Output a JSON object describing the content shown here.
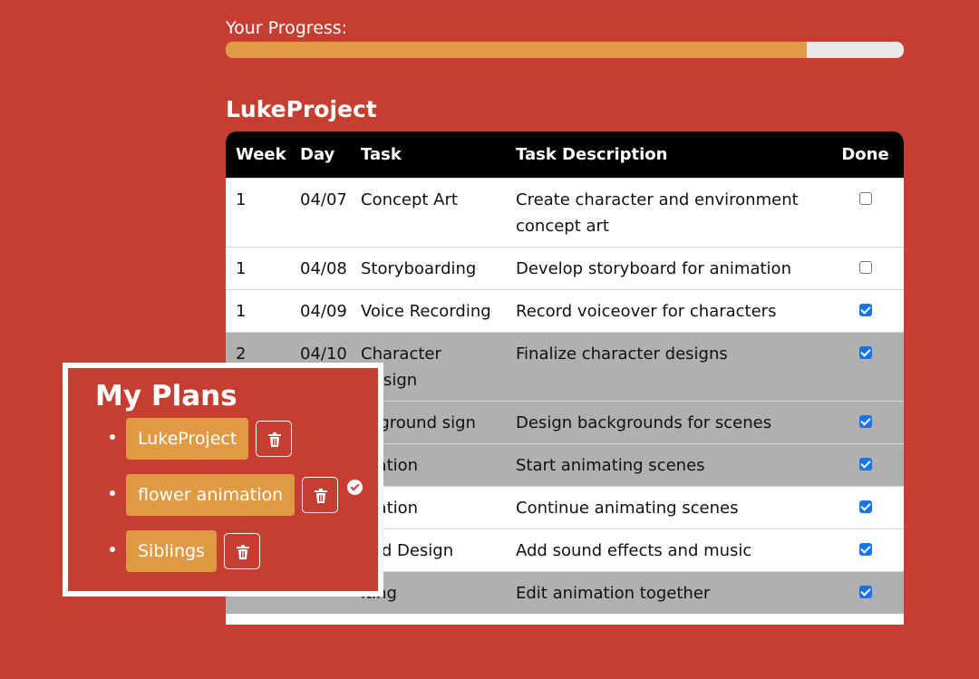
{
  "progress": {
    "label": "Your Progress:",
    "fraction": 0.857
  },
  "project": {
    "title": "LukeProject"
  },
  "table": {
    "columns": [
      "Week",
      "Day",
      "Task",
      "Task Description",
      "Done"
    ],
    "rows": [
      {
        "week": "1",
        "day": "04/07",
        "task": "Concept Art",
        "description": "Create character and environment concept art",
        "done": false,
        "shade": "white"
      },
      {
        "week": "1",
        "day": "04/08",
        "task": "Storyboarding",
        "description": "Develop storyboard for animation",
        "done": false,
        "shade": "white"
      },
      {
        "week": "1",
        "day": "04/09",
        "task": "Voice Recording",
        "description": "Record voiceover for characters",
        "done": true,
        "shade": "white"
      },
      {
        "week": "2",
        "day": "04/10",
        "task": "Character Design",
        "description": "Finalize character designs",
        "done": true,
        "shade": "gray"
      },
      {
        "week": "",
        "day": "",
        "task": "ckground sign",
        "description": "Design backgrounds for scenes",
        "done": true,
        "shade": "gray"
      },
      {
        "week": "",
        "day": "",
        "task": "mation",
        "description": "Start animating scenes",
        "done": true,
        "shade": "gray"
      },
      {
        "week": "",
        "day": "",
        "task": "mation",
        "description": "Continue animating scenes",
        "done": true,
        "shade": "white"
      },
      {
        "week": "",
        "day": "",
        "task": "und Design",
        "description": "Add sound effects and music",
        "done": true,
        "shade": "white"
      },
      {
        "week": "",
        "day": "",
        "task": "iting",
        "description": "Edit animation together",
        "done": true,
        "shade": "gray"
      }
    ]
  },
  "plans": {
    "title": "My Plans",
    "items": [
      {
        "name": "LukeProject",
        "selected": false
      },
      {
        "name": "flower animation",
        "selected": true
      },
      {
        "name": "Siblings",
        "selected": false
      }
    ],
    "delete_icon": "trash-icon",
    "selected_icon": "check-circle-icon"
  },
  "colors": {
    "background": "#c63d32",
    "accent": "#e19a43",
    "progress_track": "#e8e8ea",
    "table_header": "#000000",
    "row_gray": "#b0b0b0",
    "checkbox": "#1a73e8"
  }
}
